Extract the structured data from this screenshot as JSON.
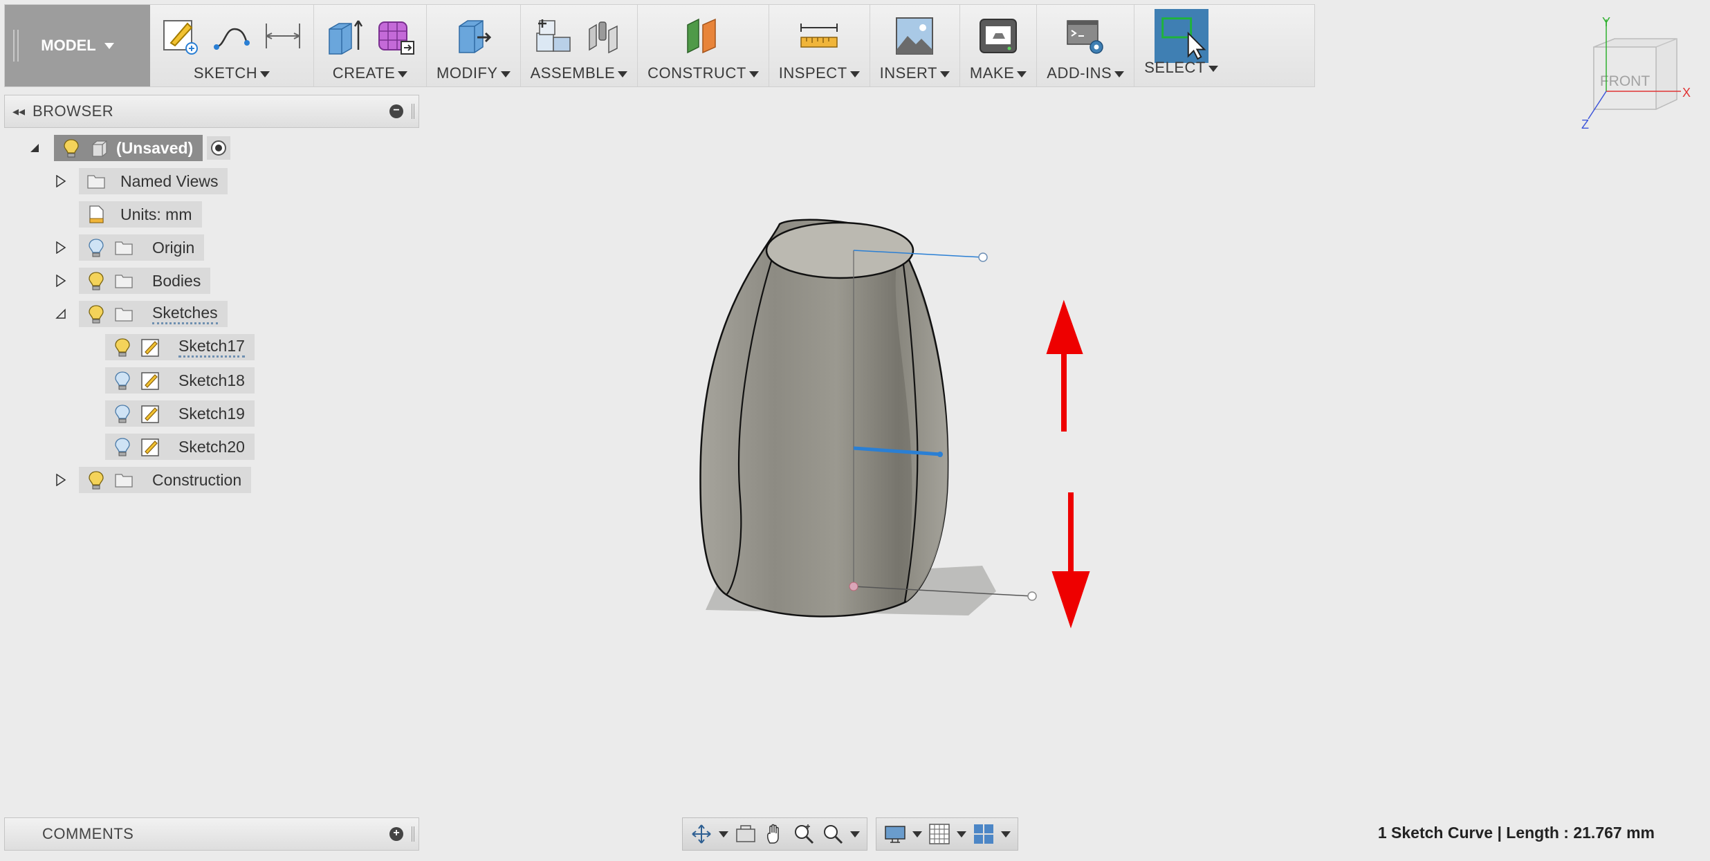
{
  "toolbar": {
    "workspace": "MODEL",
    "groups": [
      {
        "label": "SKETCH",
        "icons": [
          "create-sketch-icon",
          "spline-icon",
          "dimension-icon"
        ]
      },
      {
        "label": "CREATE",
        "icons": [
          "extrude-icon",
          "form-icon"
        ]
      },
      {
        "label": "MODIFY",
        "icons": [
          "press-pull-icon"
        ]
      },
      {
        "label": "ASSEMBLE",
        "icons": [
          "new-component-icon",
          "joint-icon"
        ]
      },
      {
        "label": "CONSTRUCT",
        "icons": [
          "offset-plane-icon"
        ]
      },
      {
        "label": "INSPECT",
        "icons": [
          "measure-icon"
        ]
      },
      {
        "label": "INSERT",
        "icons": [
          "insert-image-icon"
        ]
      },
      {
        "label": "MAKE",
        "icons": [
          "3d-print-icon"
        ]
      },
      {
        "label": "ADD-INS",
        "icons": [
          "scripts-icon"
        ]
      },
      {
        "label": "SELECT",
        "icons": [
          "select-icon"
        ]
      }
    ]
  },
  "viewcube": {
    "face": "FRONT",
    "axis_y": "Y",
    "axis_x": "X",
    "axis_z": "Z"
  },
  "browser": {
    "title": "BROWSER",
    "root": "(Unsaved)",
    "nodes": {
      "named_views": "Named Views",
      "units": "Units: mm",
      "origin": "Origin",
      "bodies": "Bodies",
      "sketches": "Sketches",
      "sketch17": "Sketch17",
      "sketch18": "Sketch18",
      "sketch19": "Sketch19",
      "sketch20": "Sketch20",
      "construction": "Construction"
    }
  },
  "comments": {
    "title": "COMMENTS"
  },
  "status": "1 Sketch Curve | Length : 21.767 mm",
  "colors": {
    "toolbar_bg": "#e8e8e8",
    "select_active": "#3f7fb3",
    "accent_red": "#ee0000",
    "sketch_blue": "#2a7fd4",
    "body_gray": "#8f8d85"
  }
}
